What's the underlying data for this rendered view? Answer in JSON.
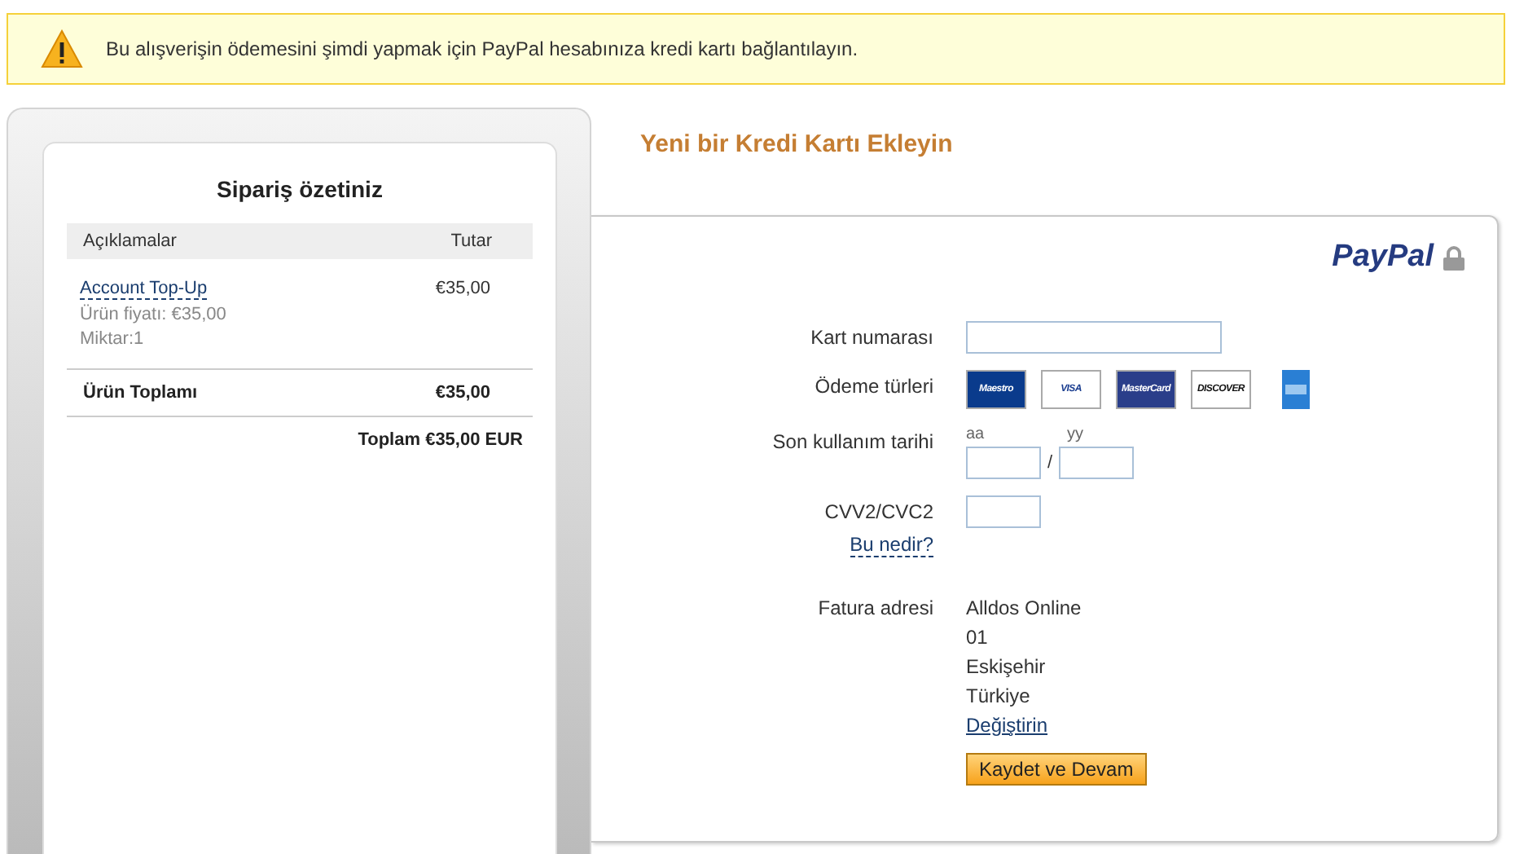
{
  "alert": {
    "text": "Bu alışverişin ödemesini şimdi yapmak için PayPal hesabınıza kredi kartı bağlantılayın."
  },
  "order_summary": {
    "title": "Sipariş özetiniz",
    "columns": [
      "Açıklamalar",
      "Tutar"
    ],
    "item": {
      "name": "Account Top-Up",
      "unit_price": "Ürün fiyatı: €35,00",
      "quantity": "Miktar:1",
      "amount": "€35,00"
    },
    "subtotal": {
      "label": "Ürün Toplamı",
      "amount": "€35,00"
    },
    "total": "Toplam €35,00 EUR"
  },
  "card_form": {
    "heading": "Yeni bir Kredi Kartı Ekleyin",
    "logo": "PayPal",
    "card_number_label": "Kart numarası",
    "payment_types_label": "Ödeme türleri",
    "payment_types": [
      {
        "kind": "maestro",
        "label": "Maestro"
      },
      {
        "kind": "visa",
        "label": "VISA"
      },
      {
        "kind": "mastercard",
        "label": "MasterCard"
      },
      {
        "kind": "discover",
        "label": "DISCOVER"
      },
      {
        "kind": "amex"
      }
    ],
    "expiry_label": "Son kullanım tarihi",
    "month_label": "aa",
    "year_label": "yy",
    "separator": "/",
    "cvv_label": "CVV2/CVC2",
    "cvv_help": "Bu nedir?",
    "billing_label": "Fatura adresi",
    "address": [
      "Alldos Online",
      "01",
      "Eskişehir",
      "Türkiye"
    ],
    "change_link": "Değiştirin",
    "submit": "Kaydet ve Devam"
  }
}
